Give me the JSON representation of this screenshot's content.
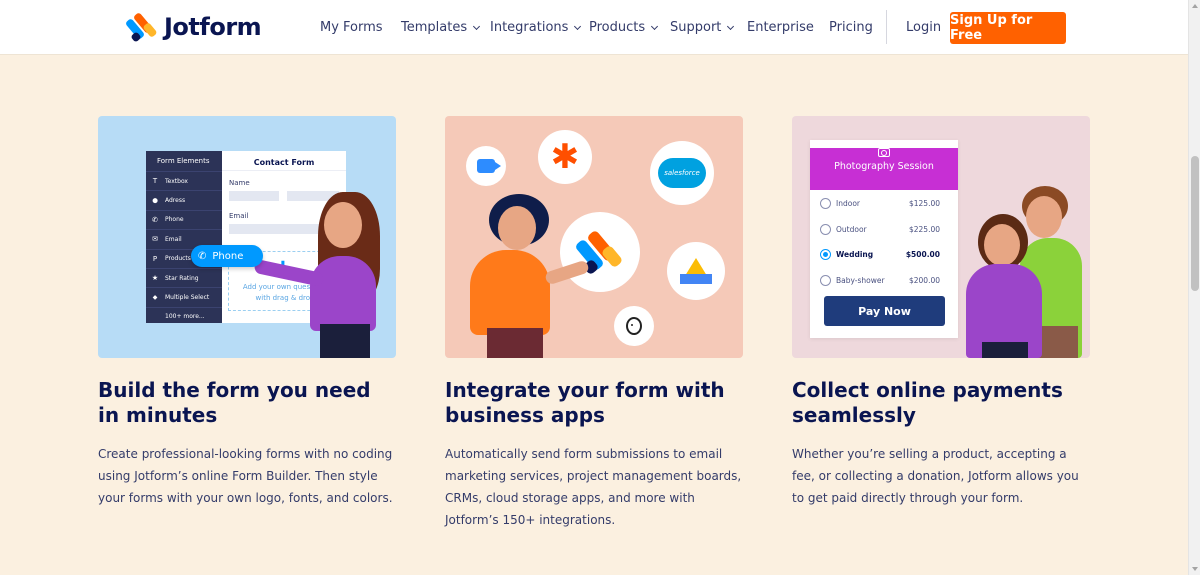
{
  "header": {
    "logo_text": "Jotform",
    "nav": [
      {
        "label": "My Forms",
        "dropdown": false
      },
      {
        "label": "Templates",
        "dropdown": true
      },
      {
        "label": "Integrations",
        "dropdown": true
      },
      {
        "label": "Products",
        "dropdown": true
      },
      {
        "label": "Support",
        "dropdown": true
      },
      {
        "label": "Enterprise",
        "dropdown": false
      },
      {
        "label": "Pricing",
        "dropdown": false
      }
    ],
    "login": "Login",
    "signup": "Sign Up for Free"
  },
  "colors": {
    "brand_orange": "#ff6100",
    "brand_blue": "#0099ff",
    "navy": "#0a1551",
    "page_bg": "#fbf0e0"
  },
  "features": [
    {
      "title": "Build the form you need in minutes",
      "description": "Create professional-looking forms with no coding using Jotform’s online Form Builder. Then style your forms with your own logo, fonts, and colors.",
      "illustration": {
        "elements_header": "Form Elements",
        "elements": [
          {
            "icon": "text-icon",
            "glyph": "T",
            "label": "Textbox"
          },
          {
            "icon": "pin-icon",
            "glyph": "⬤",
            "label": "Adress"
          },
          {
            "icon": "phone-icon",
            "glyph": "✆",
            "label": "Phone"
          },
          {
            "icon": "mail-icon",
            "glyph": "✉",
            "label": "Email"
          },
          {
            "icon": "product-icon",
            "glyph": "P",
            "label": "Products"
          },
          {
            "icon": "star-icon",
            "glyph": "★",
            "label": "Star Rating"
          },
          {
            "icon": "tag-icon",
            "glyph": "◆",
            "label": "Multiple Select"
          },
          {
            "icon": "",
            "glyph": "",
            "label": "100+ more..."
          }
        ],
        "form_title": "Contact Form",
        "name_label": "Name",
        "email_label": "Email",
        "drop_text": "Add your own questions with drag & drop",
        "drag_pill": "Phone"
      }
    },
    {
      "title": "Integrate your form with business apps",
      "description": "Automatically send form submissions to email marketing services, project management boards, CRMs, cloud storage apps, and more with Jotform’s 150+ integrations.",
      "illustration": {
        "apps": [
          "zoom-icon",
          "zapier-icon",
          "salesforce-icon",
          "jotform-icon",
          "google-drive-icon",
          "mailchimp-icon"
        ],
        "salesforce_text": "salesforce"
      }
    },
    {
      "title": "Collect online payments seamlessly",
      "description": "Whether you’re selling a product, accepting a fee, or collecting a donation, Jotform allows you to get paid directly through your form.",
      "illustration": {
        "payment_title": "Photography Session",
        "options": [
          {
            "label": "Indoor",
            "price": "$125.00",
            "selected": false
          },
          {
            "label": "Outdoor",
            "price": "$225.00",
            "selected": false
          },
          {
            "label": "Wedding",
            "price": "$500.00",
            "selected": true
          },
          {
            "label": "Baby-shower",
            "price": "$200.00",
            "selected": false
          }
        ],
        "pay_button": "Pay Now"
      }
    }
  ]
}
